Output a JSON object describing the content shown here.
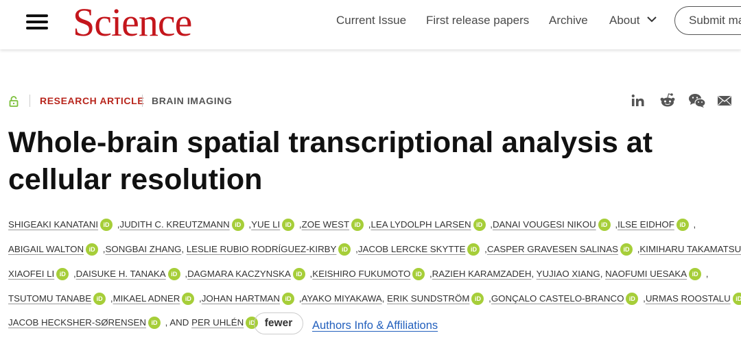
{
  "header": {
    "logo": "Science",
    "nav": [
      "Current Issue",
      "First release papers",
      "Archive",
      "About"
    ],
    "submit": "Submit ma"
  },
  "article": {
    "type": "RESEARCH ARTICLE",
    "subject": "BRAIN IMAGING",
    "title": "Whole-brain spatial transcriptional analysis at cellular resolution",
    "orcid_label": "iD",
    "lines": [
      [
        {
          "name": "SHIGEAKI KANATANI",
          "orcid": true,
          "sep": " ,"
        },
        {
          "name": "JUDITH C. KREUTZMANN",
          "orcid": true,
          "sep": " ,"
        },
        {
          "name": "YUE LI",
          "orcid": true,
          "sep": " ,"
        },
        {
          "name": "ZOE WEST",
          "orcid": true,
          "sep": " ,"
        },
        {
          "name": "LEA LYDOLPH LARSEN",
          "orcid": true,
          "sep": " ,"
        },
        {
          "name": "DANAI VOUGESI NIKOU",
          "orcid": true,
          "sep": " ,"
        },
        {
          "name": "ILSE EIDHOF",
          "orcid": true,
          "sep": " ,"
        }
      ],
      [
        {
          "name": "ABIGAIL WALTON",
          "orcid": true,
          "sep": " ,"
        },
        {
          "name": "SONGBAI ZHANG",
          "orcid": false,
          "sep": ", "
        },
        {
          "name": "LESLIE RUBIO RODRÍGUEZ-KIRBY",
          "orcid": true,
          "sep": " ,"
        },
        {
          "name": "JACOB LERCKE SKYTTE",
          "orcid": true,
          "sep": " ,"
        },
        {
          "name": "CASPER GRAVESEN SALINAS",
          "orcid": true,
          "sep": " ,"
        },
        {
          "name": "KIMIHARU TAKAMATSU",
          "orcid": true,
          "sep": " ,"
        }
      ],
      [
        {
          "name": "XIAOFEI LI",
          "orcid": true,
          "sep": " ,"
        },
        {
          "name": "DAISUKE H. TANAKA",
          "orcid": true,
          "sep": " ,"
        },
        {
          "name": "DAGMARA KACZYNSKA",
          "orcid": true,
          "sep": " ,"
        },
        {
          "name": "KEISHIRO FUKUMOTO",
          "orcid": true,
          "sep": " ,"
        },
        {
          "name": "RAZIEH KARAMZADEH",
          "orcid": false,
          "sep": ", "
        },
        {
          "name": "YUJIAO XIANG",
          "orcid": false,
          "sep": ", "
        },
        {
          "name": "NAOFUMI UESAKA",
          "orcid": true,
          "sep": " ,"
        }
      ],
      [
        {
          "name": "TSUTOMU TANABE",
          "orcid": true,
          "sep": " ,"
        },
        {
          "name": "MIKAEL ADNER",
          "orcid": true,
          "sep": " ,"
        },
        {
          "name": "JOHAN HARTMAN",
          "orcid": true,
          "sep": " ,"
        },
        {
          "name": "AYAKO MIYAKAWA",
          "orcid": false,
          "sep": ", "
        },
        {
          "name": "ERIK SUNDSTRÖM",
          "orcid": true,
          "sep": " ,"
        },
        {
          "name": "GONÇALO CASTELO-BRANCO",
          "orcid": true,
          "sep": " ,"
        },
        {
          "name": "URMAS ROOSTALU",
          "orcid": true,
          "sep": " ,"
        }
      ],
      [
        {
          "name": "JACOB HECKSHER-SØRENSEN",
          "orcid": true,
          "sep": " , AND "
        },
        {
          "name": "PER UHLÉN",
          "orcid": true,
          "sep": ""
        }
      ]
    ],
    "fewer_label": "fewer",
    "affiliations_link": "Authors Info & Affiliations"
  },
  "icons": [
    "lock-icon",
    "linkedin-icon",
    "reddit-icon",
    "wechat-icon",
    "email-icon",
    "chevron-down-icon",
    "menu-icon",
    "orcid-icon"
  ],
  "colors": {
    "brand": "#c4161c",
    "article_type": "#b8261d",
    "orcid": "#a6ce39",
    "link": "#2360bd"
  }
}
